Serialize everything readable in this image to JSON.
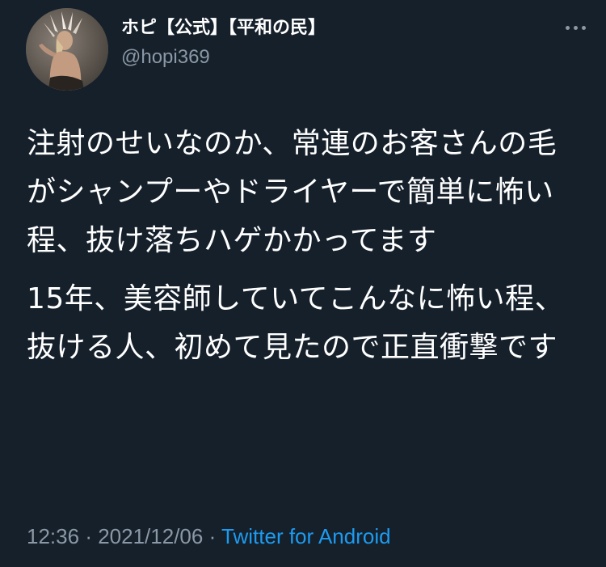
{
  "tweet": {
    "author": {
      "display_name": "ホピ【公式】【平和の民】",
      "handle": "@hopi369"
    },
    "paragraphs": [
      "注射のせいなのか、常連のお客さんの毛がシャンプーやドライヤーで簡単に怖い程、抜け落ちハゲかかってます",
      "15年、美容師していてこんなに怖い程、抜ける人、初めて見たので正直衝撃です"
    ],
    "time": "12:36",
    "separator": "·",
    "date": "2021/12/06",
    "source": "Twitter for Android"
  },
  "icons": {
    "more": "more-dots-icon",
    "avatar": "profile-avatar"
  },
  "colors": {
    "background": "#15202b",
    "text": "#ffffff",
    "secondary": "#8b98a5",
    "link": "#1d9bf0"
  }
}
